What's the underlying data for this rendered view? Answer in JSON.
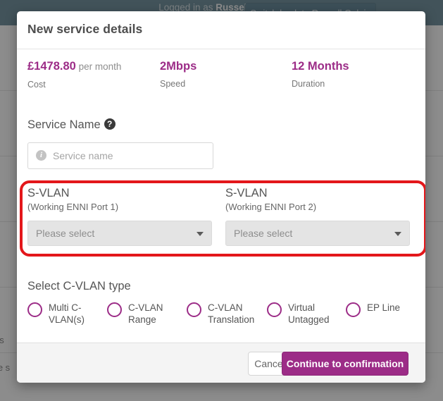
{
  "background": {
    "logged_in_prefix": "Logged in as ",
    "logged_in_user": "Russell. Galpin",
    "switch_button_label": "Switch back to Russell Galpin",
    "snippet_1": "ps",
    "snippet_2": "the s"
  },
  "modal": {
    "title": "New service details",
    "stats": [
      {
        "value": "£1478.80",
        "suffix": " per month",
        "label": "Cost"
      },
      {
        "value": "2Mbps",
        "suffix": "",
        "label": "Speed"
      },
      {
        "value": "12 Months",
        "suffix": "",
        "label": "Duration"
      }
    ],
    "service_name": {
      "label": "Service Name",
      "help_icon": "question-mark-icon",
      "input_icon": "info-icon",
      "placeholder": "Service name",
      "value": ""
    },
    "svlan": [
      {
        "title": "S-VLAN",
        "subtitle": "(Working ENNI Port 1)",
        "selected": "Please select"
      },
      {
        "title": "S-VLAN",
        "subtitle": "(Working ENNI Port 2)",
        "selected": "Please select"
      }
    ],
    "cvlan": {
      "heading": "Select C-VLAN type",
      "options": [
        {
          "label": "Multi C-VLAN(s)",
          "selected": false
        },
        {
          "label": "C-VLAN Range",
          "selected": false
        },
        {
          "label": "C-VLAN Translation",
          "selected": false
        },
        {
          "label": "Virtual Untagged",
          "selected": false
        },
        {
          "label": "EP Line",
          "selected": false
        }
      ]
    },
    "footer": {
      "cancel_label": "Cancel",
      "continue_label": "Continue to confirmation"
    }
  },
  "colors": {
    "accent_purple": "#9c2c87",
    "highlight_red": "#e3171b",
    "topbar_teal": "#3d6a7d"
  }
}
